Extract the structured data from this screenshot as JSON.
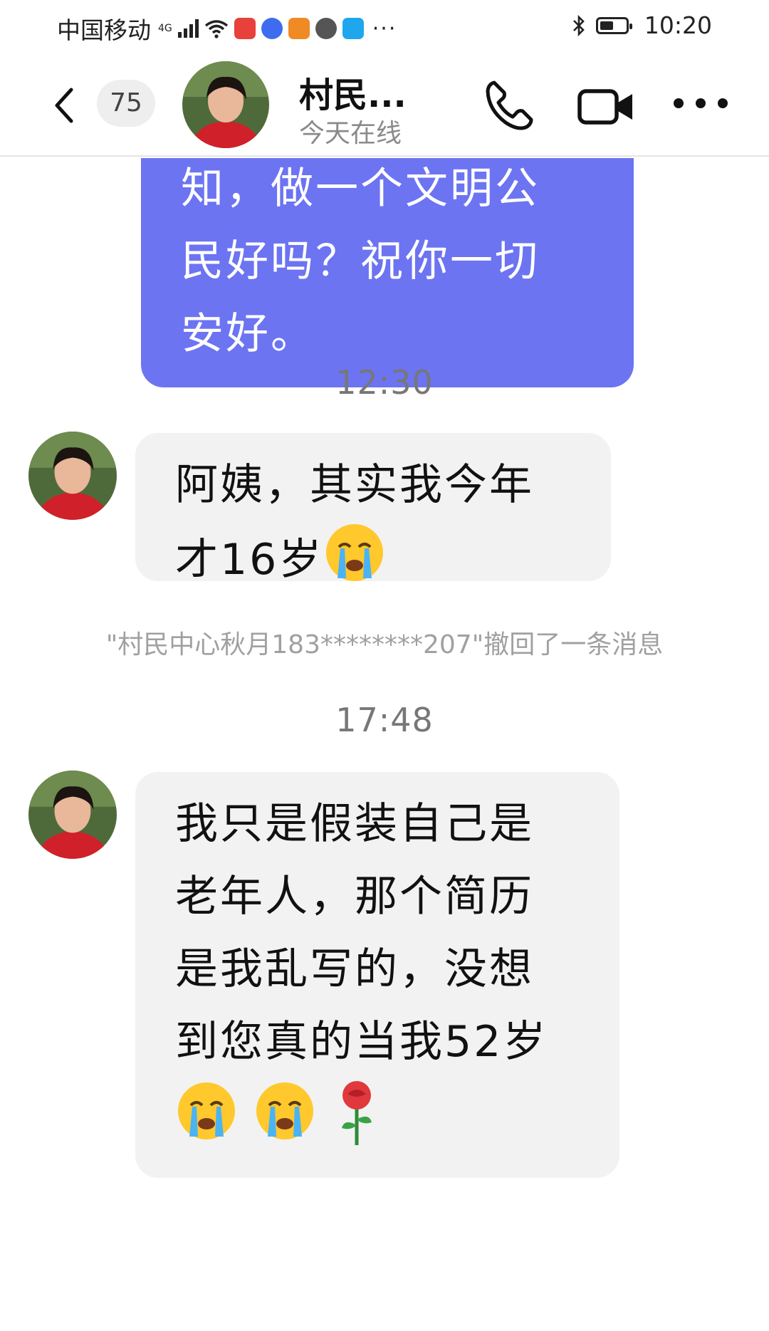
{
  "status_bar": {
    "carrier": "中国移动",
    "network": "4G",
    "time": "10:20"
  },
  "header": {
    "unread_count": "75",
    "contact_name": "村民...",
    "contact_status": "今天在线"
  },
  "messages": {
    "outgoing_1_lines": [
      "知，做一个文明公",
      "民好吗？祝你一切",
      "安好。"
    ],
    "time_1": "12:30",
    "incoming_1_line1": "阿姨，其实我今年",
    "incoming_1_line2": "才16岁",
    "recall_notice": "\"村民中心秋月183********207\"撤回了一条消息",
    "time_2": "17:48",
    "incoming_2_lines": [
      "我只是假装自己是",
      "老年人，那个简历",
      "是我乱写的，没想",
      "到您真的当我52岁"
    ]
  },
  "colors": {
    "outgoing_bubble": "#6c74f2",
    "incoming_bubble": "#f2f2f2",
    "app_icon_red": "#e8403a",
    "app_icon_blue": "#3d6cf0",
    "app_icon_orange": "#f08a24",
    "app_icon_cyan": "#1fa7ee"
  },
  "icons": {
    "back": "chevron-left-icon",
    "call": "phone-icon",
    "video": "video-camera-icon",
    "more": "more-dots-icon",
    "emoji_cry": "loudly-crying-face-emoji",
    "emoji_rose": "rose-emoji"
  }
}
